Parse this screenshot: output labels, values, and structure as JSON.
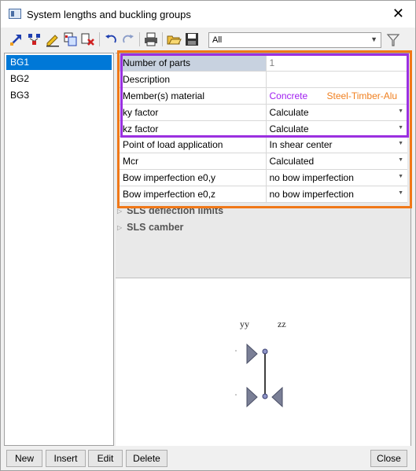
{
  "window": {
    "title": "System lengths and buckling groups",
    "close_glyph": "✕"
  },
  "toolbar": {
    "filter_value": "All",
    "icons": [
      "select-icon",
      "connect-icon",
      "edit-icon",
      "copy-icon",
      "delete-icon",
      "undo-icon",
      "redo-icon",
      "print-icon",
      "open-icon",
      "save-icon",
      "filter-icon"
    ]
  },
  "groups": [
    {
      "label": "BG1",
      "selected": true
    },
    {
      "label": "BG2",
      "selected": false
    },
    {
      "label": "BG3",
      "selected": false
    }
  ],
  "properties": [
    {
      "label": "Number of parts",
      "value": "1",
      "dropdown": false,
      "grey": true
    },
    {
      "label": "Description",
      "value": "",
      "dropdown": false,
      "grey": false
    },
    {
      "label": "Member(s) material",
      "value": "Concrete",
      "value2": "Steel-Timber-Alu",
      "dropdown": false,
      "grey": false
    },
    {
      "label": "ky factor",
      "value": "Calculate",
      "dropdown": true,
      "grey": false
    },
    {
      "label": "kz factor",
      "value": "Calculate",
      "dropdown": true,
      "grey": false
    },
    {
      "label": "Point of load application",
      "value": "In shear center",
      "dropdown": true,
      "grey": false
    },
    {
      "label": "Mcr",
      "value": "Calculated",
      "dropdown": true,
      "grey": false
    },
    {
      "label": "Bow imperfection e0,y",
      "value": "no bow imperfection",
      "dropdown": true,
      "grey": false
    },
    {
      "label": "Bow imperfection e0,z",
      "value": "no bow imperfection",
      "dropdown": true,
      "grey": false
    }
  ],
  "sections": [
    {
      "label": "SLS deflection limits"
    },
    {
      "label": "SLS camber"
    }
  ],
  "diagram": {
    "label_y": "yy",
    "label_z": "zz"
  },
  "buttons": {
    "new": "New",
    "insert": "Insert",
    "edit": "Edit",
    "delete": "Delete",
    "close": "Close"
  },
  "highlight_colors": {
    "orange": "#f07818",
    "purple": "#9b30e0"
  }
}
